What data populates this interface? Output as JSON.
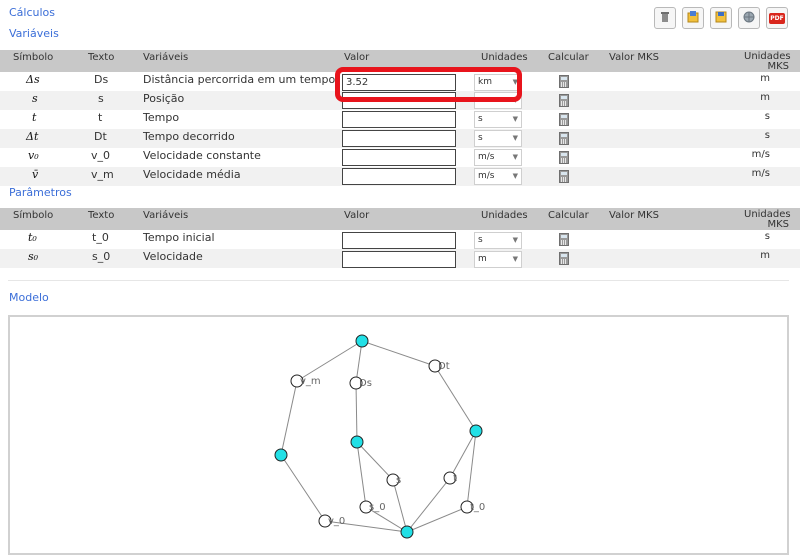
{
  "links": {
    "calculos": "Cálculos",
    "variaveis": "Variáveis",
    "parametros": "Parâmetros",
    "modelo": "Modelo"
  },
  "toolbar": [
    {
      "name": "trash-button",
      "icon": "trash-icon"
    },
    {
      "name": "load-button",
      "icon": "folder-icon"
    },
    {
      "name": "save-button",
      "icon": "disk-icon"
    },
    {
      "name": "globe-button",
      "icon": "globe-icon"
    },
    {
      "name": "pdf-button",
      "icon": "pdf-icon",
      "label": "PDF"
    }
  ],
  "headers": {
    "simbolo": "Símbolo",
    "texto": "Texto",
    "variaveis": "Variáveis",
    "valor": "Valor",
    "unidades": "Unidades",
    "calcular": "Calcular",
    "valor_mks": "Valor MKS",
    "unidades_mks": "Unidades MKS"
  },
  "variables": [
    {
      "symbol": "Δs",
      "text": "Ds",
      "desc": "Distância percorrida em um tempo",
      "value": "3.52",
      "unit": "km",
      "mks": "m"
    },
    {
      "symbol": "s",
      "text": "s",
      "desc": "Posição",
      "value": "",
      "unit": "m",
      "mks": "m"
    },
    {
      "symbol": "t",
      "text": "t",
      "desc": "Tempo",
      "value": "",
      "unit": "s",
      "mks": "s"
    },
    {
      "symbol": "Δt",
      "text": "Dt",
      "desc": "Tempo decorrido",
      "value": "",
      "unit": "s",
      "mks": "s"
    },
    {
      "symbol": "v₀",
      "text": "v_0",
      "desc": "Velocidade constante",
      "value": "",
      "unit": "m/s",
      "mks": "m/s"
    },
    {
      "symbol": "v̄",
      "text": "v_m",
      "desc": "Velocidade média",
      "value": "",
      "unit": "m/s",
      "mks": "m/s"
    }
  ],
  "parameters": [
    {
      "symbol": "t₀",
      "text": "t_0",
      "desc": "Tempo inicial",
      "value": "",
      "unit": "s",
      "mks": "s"
    },
    {
      "symbol": "s₀",
      "text": "s_0",
      "desc": "Velocidade",
      "value": "",
      "unit": "m",
      "mks": "m"
    }
  ],
  "graph": {
    "nodes": [
      {
        "id": "n1",
        "label": "",
        "filled": true
      },
      {
        "id": "vm",
        "label": "v_m",
        "filled": false
      },
      {
        "id": "ds",
        "label": "Ds",
        "filled": false
      },
      {
        "id": "dt",
        "label": "Dt",
        "filled": false
      },
      {
        "id": "n2",
        "label": "",
        "filled": true
      },
      {
        "id": "n3",
        "label": "",
        "filled": true
      },
      {
        "id": "n4",
        "label": "",
        "filled": true
      },
      {
        "id": "s",
        "label": "s",
        "filled": false
      },
      {
        "id": "t",
        "label": "t",
        "filled": false
      },
      {
        "id": "s0",
        "label": "s_0",
        "filled": false
      },
      {
        "id": "t0",
        "label": "t_0",
        "filled": false
      },
      {
        "id": "v0",
        "label": "v_0",
        "filled": false
      },
      {
        "id": "n5",
        "label": "",
        "filled": true
      }
    ],
    "edges": [
      [
        "n1",
        "vm"
      ],
      [
        "n1",
        "ds"
      ],
      [
        "n1",
        "dt"
      ],
      [
        "vm",
        "n2"
      ],
      [
        "ds",
        "n3"
      ],
      [
        "dt",
        "n4"
      ],
      [
        "n2",
        "v0"
      ],
      [
        "n3",
        "s"
      ],
      [
        "n3",
        "s0"
      ],
      [
        "n4",
        "t"
      ],
      [
        "n4",
        "t0"
      ],
      [
        "v0",
        "n5"
      ],
      [
        "s",
        "n5"
      ],
      [
        "s0",
        "n5"
      ],
      [
        "t",
        "n5"
      ],
      [
        "t0",
        "n5"
      ]
    ]
  }
}
